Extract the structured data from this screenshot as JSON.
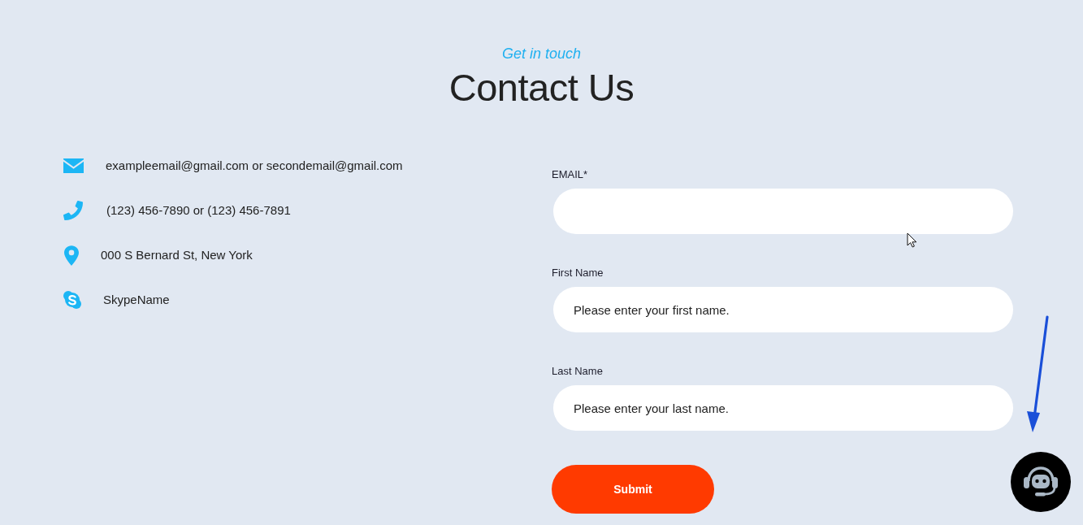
{
  "header": {
    "eyebrow": "Get in touch",
    "title": "Contact Us"
  },
  "contacts": [
    {
      "kind": "email",
      "text": "exampleemail@gmail.com or secondemail@gmail.com"
    },
    {
      "kind": "phone",
      "text": "(123) 456-7890 or (123) 456-7891"
    },
    {
      "kind": "location",
      "text": "000 S Bernard St, New York"
    },
    {
      "kind": "skype",
      "text": "SkypeName"
    }
  ],
  "form": {
    "fields": [
      {
        "label": "EMAIL*"
      },
      {
        "label": "First Name",
        "placeholder": "Please enter your first name."
      },
      {
        "label": "Last Name",
        "placeholder": "Please enter your last name."
      }
    ],
    "submit": "Submit"
  }
}
